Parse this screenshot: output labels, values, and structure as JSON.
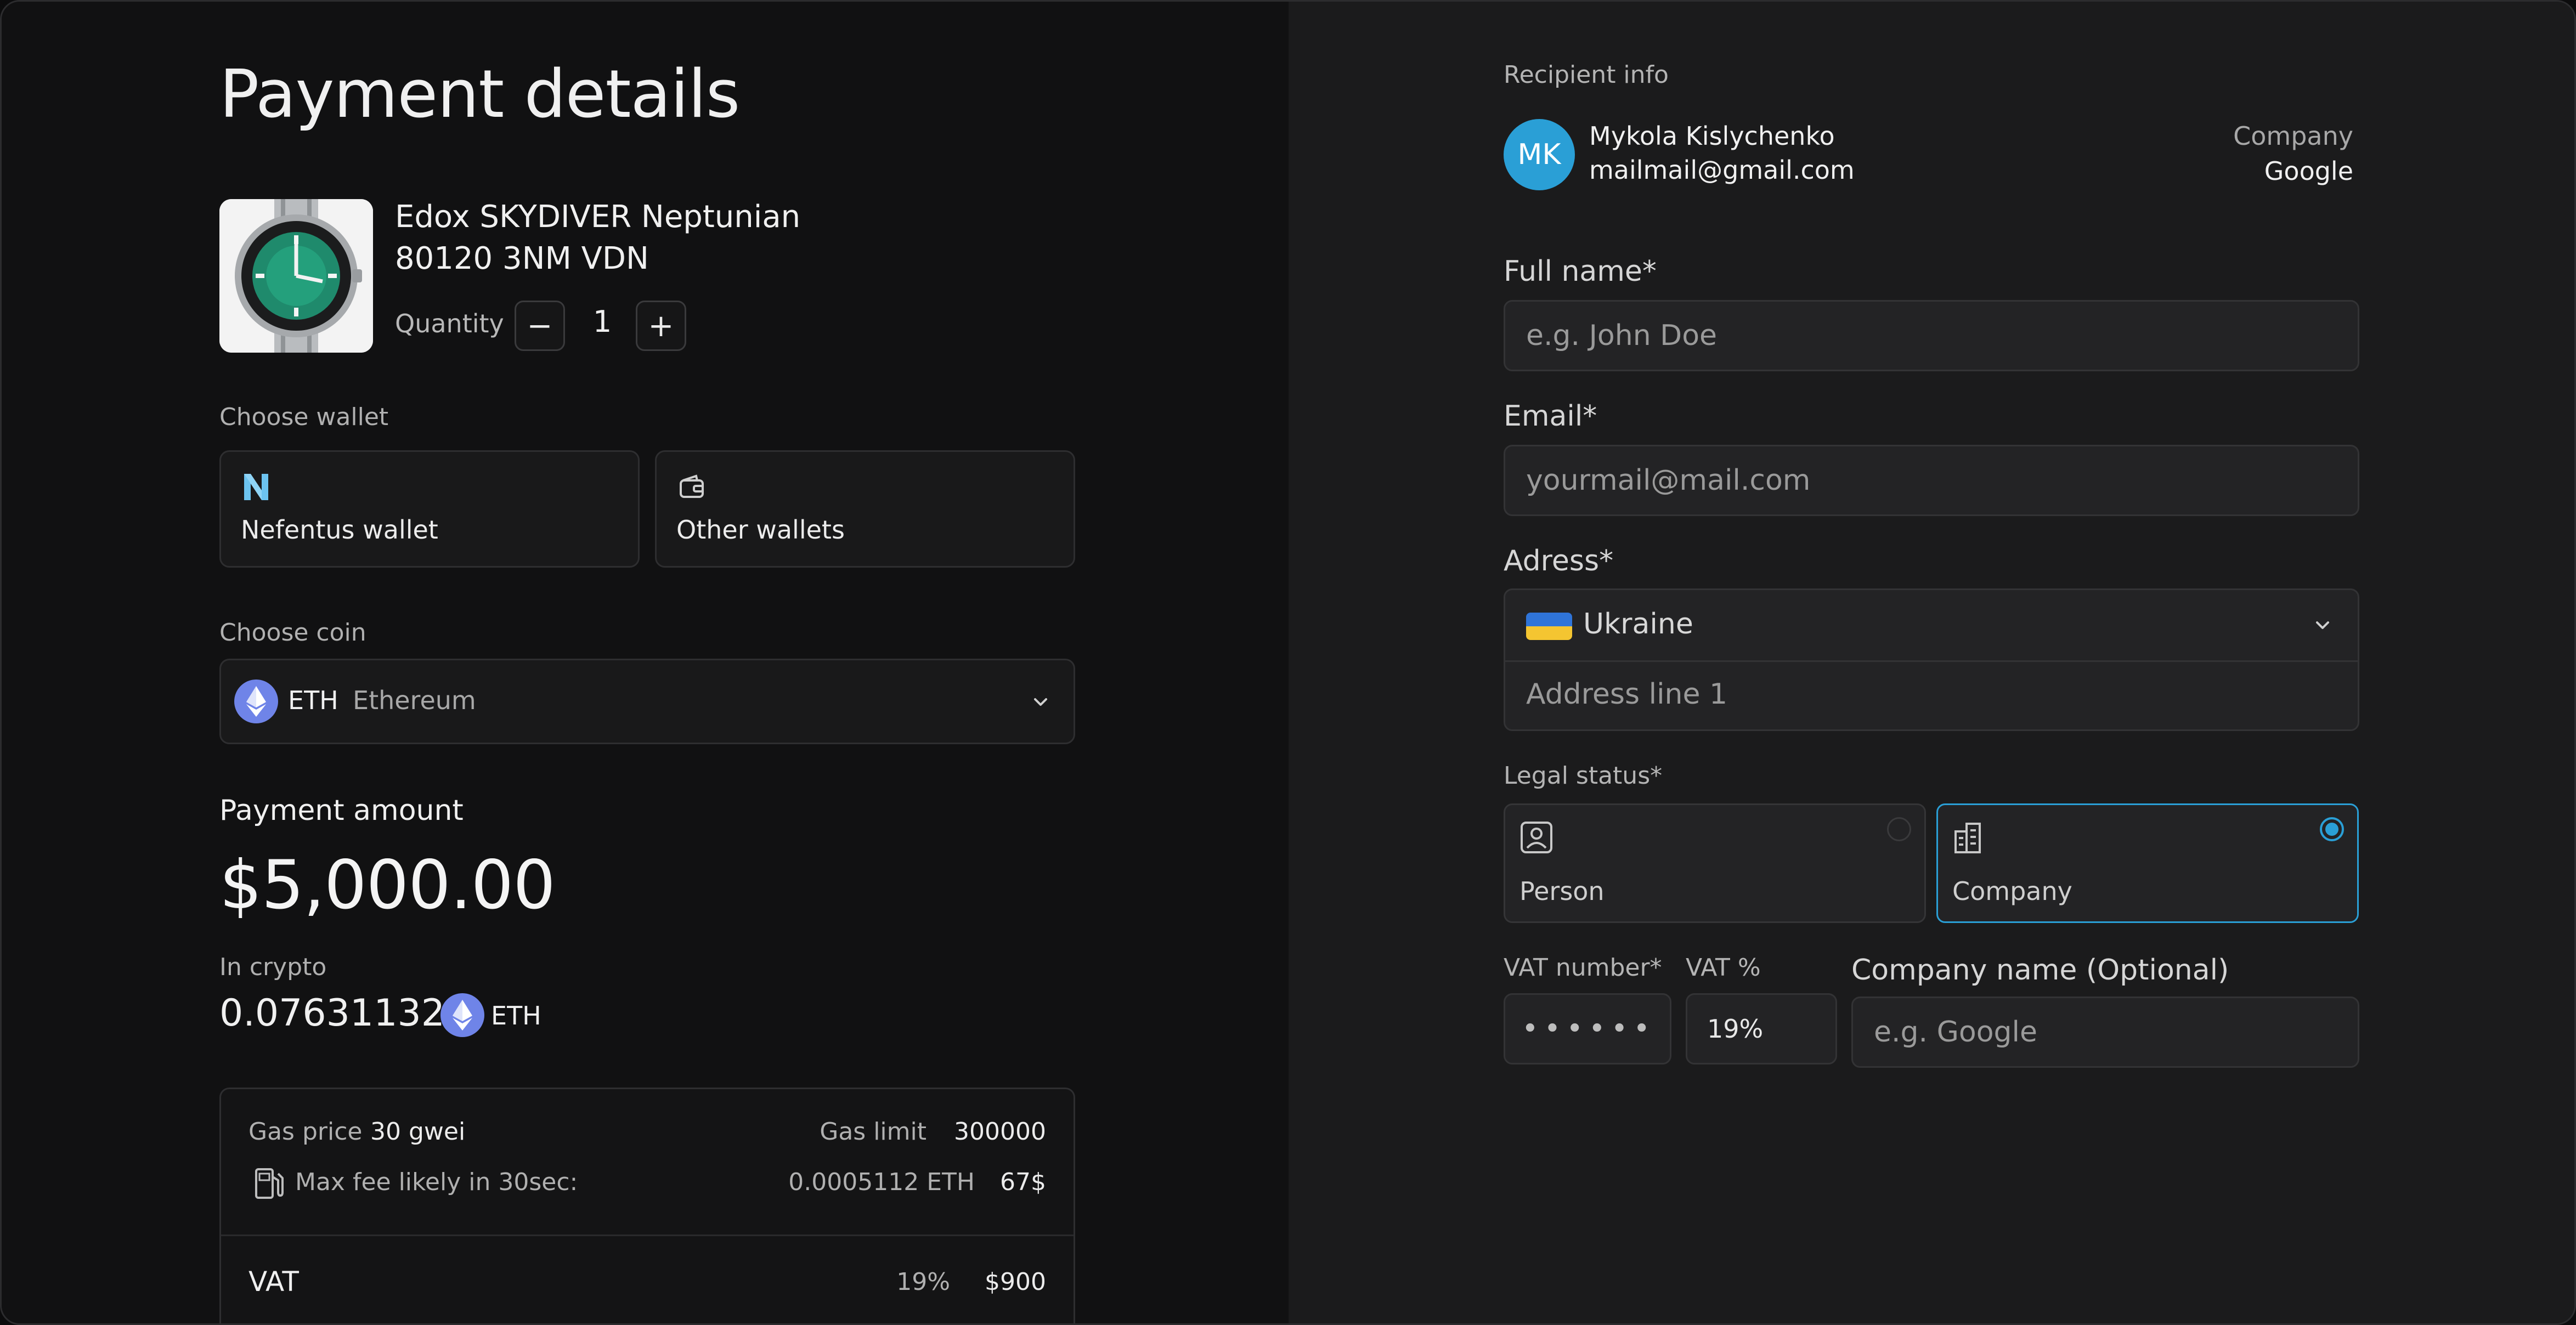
{
  "payment": {
    "title": "Payment details",
    "product": {
      "name_line1": "Edox SKYDIVER Neptunian",
      "name_line2": "80120 3NM VDN",
      "quantity_label": "Quantity",
      "quantity": "1",
      "minus": "−",
      "plus": "+"
    },
    "wallet": {
      "label": "Choose wallet",
      "options": [
        {
          "label": "Nefentus wallet",
          "icon": "nefentus-logo-icon"
        },
        {
          "label": "Other wallets",
          "icon": "wallet-icon"
        }
      ]
    },
    "coin": {
      "label": "Choose coin",
      "ticker": "ETH",
      "name": "Ethereum"
    },
    "amount": {
      "label": "Payment amount",
      "value": "$5,000.00",
      "crypto_label": "In crypto",
      "crypto_value": "0.076311321",
      "crypto_ticker": "ETH"
    },
    "fees": {
      "gas_price_label": "Gas price",
      "gas_price_value": "30 gwei",
      "gas_limit_label": "Gas limit",
      "gas_limit_value": "300000",
      "max_fee_label": "Max fee likely in 30sec:",
      "max_fee_eth": "0.0005112 ETH",
      "max_fee_usd": "67$",
      "vat_label": "VAT",
      "vat_percent": "19%",
      "vat_value": "$900"
    }
  },
  "recipient": {
    "section_label": "Recipient info",
    "initials": "MK",
    "name": "Mykola Kislychenko",
    "email": "mailmail@gmail.com",
    "company_label": "Company",
    "company_value": "Google"
  },
  "form": {
    "full_name": {
      "label": "Full name*",
      "placeholder": "e.g. John Doe"
    },
    "email": {
      "label": "Email*",
      "placeholder": "yourmail@mail.com"
    },
    "address": {
      "label": "Adress*",
      "country": "Ukraine",
      "line1_placeholder": "Address line 1"
    },
    "legal": {
      "label": "Legal status*",
      "options": [
        {
          "label": "Person",
          "selected": false
        },
        {
          "label": "Company",
          "selected": true
        }
      ]
    },
    "vat_number": {
      "label": "VAT number*",
      "value": "••••••"
    },
    "vat_percent": {
      "label": "VAT %",
      "value": "19%"
    },
    "company_name": {
      "label": "Company name (Optional)",
      "placeholder": "e.g. Google"
    }
  },
  "colors": {
    "accent": "#2a9fd6",
    "eth": "#6f84e8",
    "panel_left": "#111112",
    "panel_right": "#1b1b1c"
  }
}
